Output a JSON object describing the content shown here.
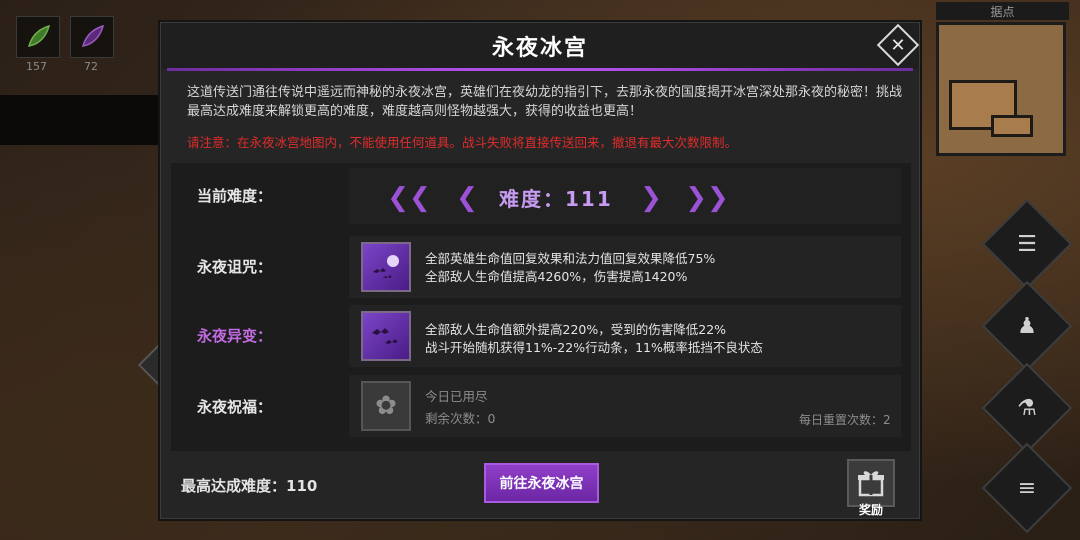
{
  "background": {
    "slots": [
      {
        "count": "157",
        "icon": "green-leaf-icon"
      },
      {
        "count": "72",
        "icon": "purple-feather-icon"
      }
    ],
    "map_label": "据点"
  },
  "dialog": {
    "title": "永夜冰宫",
    "description": "这道传送门通往传说中遥远而神秘的永夜冰宫，英雄们在夜幼龙的指引下，去那永夜的国度揭开冰宫深处那永夜的秘密！挑战最高达成难度来解锁更高的难度，难度越高则怪物越强大，获得的收益也更高！",
    "warning": "请注意：在永夜冰宫地图内，不能使用任何道具。战斗失败将直接传送回来，撤退有最大次数限制。",
    "difficulty": {
      "label": "当前难度：",
      "value": "难度：111"
    },
    "curse": {
      "label": "永夜诅咒：",
      "icon": "bats-moon-icon",
      "lines": [
        "全部英雄生命值回复效果和法力值回复效果降低75%",
        "全部敌人生命值提高4260%，伤害提高1420%"
      ]
    },
    "mutation": {
      "label": "永夜异变：",
      "icon": "bats-icon",
      "lines": [
        "全部敌人生命值额外提高220%，受到的伤害降低22%",
        "战斗开始随机获得11%-22%行动条，11%概率抵挡不良状态"
      ]
    },
    "blessing": {
      "label": "永夜祝福：",
      "icon": "vortex-icon",
      "status": "今日已用尽",
      "remaining": "剩余次数：0",
      "daily_reset": "每日重置次数：2"
    },
    "max_difficulty": "最高达成难度：110",
    "go_button": "前往永夜冰宫",
    "reward_label": "奖励"
  },
  "colors": {
    "accent_purple": "#9c52d6",
    "warning_red": "#e02c2c",
    "mutation_label": "#c26be0"
  }
}
